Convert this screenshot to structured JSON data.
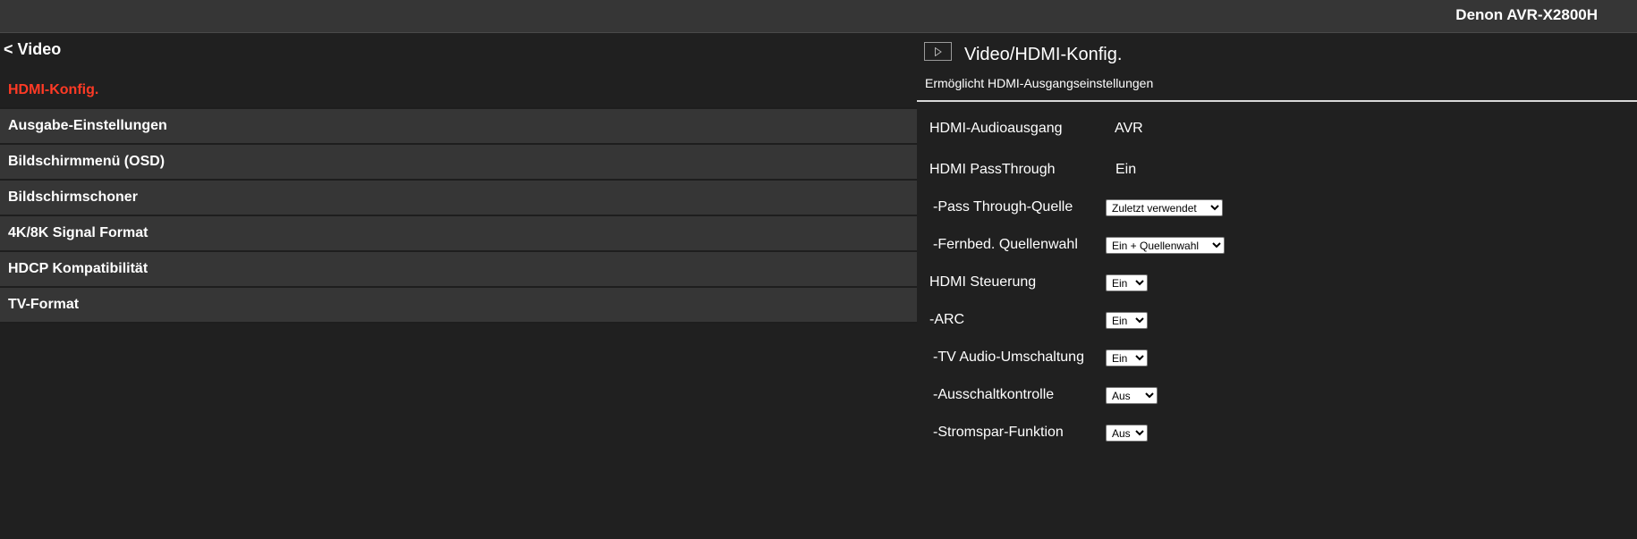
{
  "header": {
    "model": "Denon AVR-X2800H"
  },
  "nav": {
    "back_label": "< Video",
    "items": [
      {
        "label": "HDMI-Konfig."
      },
      {
        "label": "Ausgabe-Einstellungen"
      },
      {
        "label": "Bildschirmmenü (OSD)"
      },
      {
        "label": "Bildschirmschoner"
      },
      {
        "label": "4K/8K Signal Format"
      },
      {
        "label": "HDCP Kompatibilität"
      },
      {
        "label": "TV-Format"
      }
    ],
    "active_index": 0
  },
  "main": {
    "title": "Video/HDMI-Konfig.",
    "description": "Ermöglicht HDMI-Ausgangseinstellungen",
    "play_icon": "play-icon",
    "settings": [
      {
        "label": "HDMI-Audioausgang",
        "value": "AVR"
      },
      {
        "label": "HDMI PassThrough",
        "value": "Ein"
      },
      {
        "label": "-Pass Through-Quelle",
        "value": "Zuletzt verwendet"
      },
      {
        "label": "-Fernbed. Quellenwahl",
        "value": "Ein + Quellenwahl"
      },
      {
        "label": "HDMI Steuerung",
        "value": "Ein"
      },
      {
        "label": "-ARC",
        "value": "Ein"
      },
      {
        "label": "-TV Audio-Umschaltung",
        "value": "Ein"
      },
      {
        "label": "-Ausschaltkontrolle",
        "value": "Aus"
      },
      {
        "label": "-Stromspar-Funktion",
        "value": "Aus"
      }
    ]
  },
  "colors": {
    "background": "#202020",
    "bar": "#363636",
    "active": "#ff3a25",
    "text": "#ffffff"
  }
}
